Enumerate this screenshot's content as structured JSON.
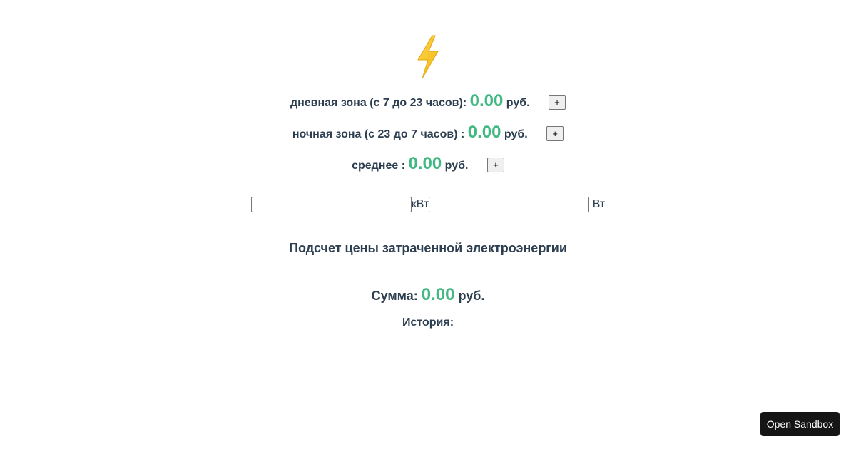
{
  "icon": "high-voltage-icon",
  "colors": {
    "text": "#2c3e50",
    "accent": "#42b983",
    "bolt": "#f4c430",
    "sandbox_button_bg": "#151515"
  },
  "rates": {
    "day": {
      "label": "дневная зона (с 7 до 23 часов):",
      "amount": "0.00",
      "currency": "руб.",
      "button_label": "+"
    },
    "night": {
      "label": "ночная зона (с 23 до 7 часов) :",
      "amount": "0.00",
      "currency": "руб.",
      "button_label": "+"
    },
    "average": {
      "label": "среднее :",
      "amount": "0.00",
      "currency": "руб.",
      "button_label": "+"
    }
  },
  "inputs": {
    "kw": {
      "value": "",
      "unit": "кВт"
    },
    "w": {
      "value": "",
      "unit": "Вт"
    }
  },
  "heading": "Подсчет цены затраченной электроэнергии",
  "sum": {
    "label": "Сумма:",
    "amount": "0.00",
    "currency": "руб."
  },
  "history_label": "История:",
  "sandbox_button": "Open Sandbox"
}
